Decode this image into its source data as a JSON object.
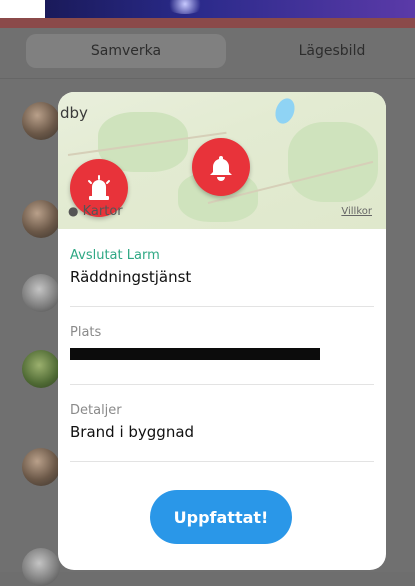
{
  "background": {
    "tabs": [
      {
        "label": "Samverka",
        "active": true
      },
      {
        "label": "Lägesbild",
        "active": false
      }
    ]
  },
  "modal": {
    "map": {
      "place_label": "dby",
      "attribution": "Kartor",
      "terms_link": "Villkor"
    },
    "status": {
      "label": "Avslutat Larm",
      "value": "Räddningstjänst"
    },
    "location": {
      "label": "Plats",
      "value_redacted": true
    },
    "details": {
      "label": "Detaljer",
      "value": "Brand i byggnad"
    },
    "acknowledge_button": "Uppfattat!"
  },
  "colors": {
    "accent_green": "#2fa884",
    "button_blue": "#2a97e8",
    "pin_red": "#e8333a"
  },
  "icons": [
    "siren-icon",
    "bell-icon",
    "apple-icon"
  ]
}
